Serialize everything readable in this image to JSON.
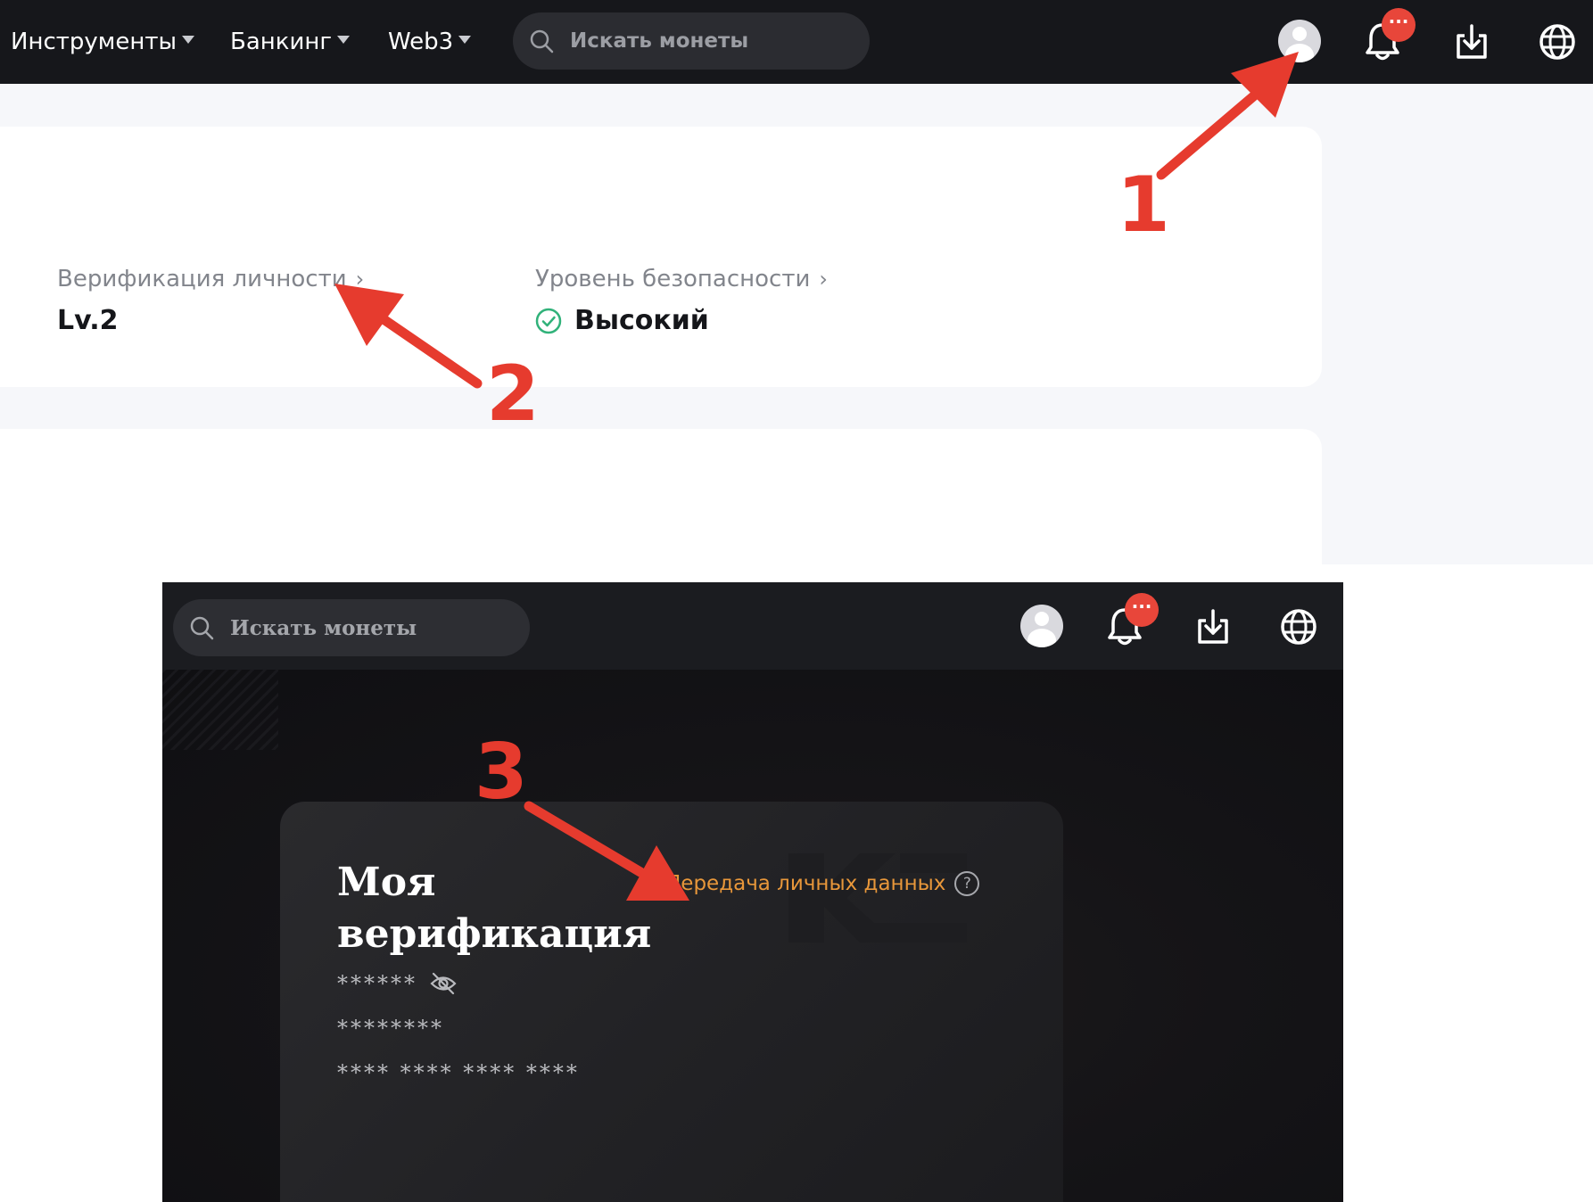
{
  "top": {
    "nav": [
      "Инструменты",
      "Банкинг",
      "Web3"
    ],
    "search_placeholder": "Искать монеты",
    "notification_badge": "···",
    "icons": [
      "search-icon",
      "avatar-icon",
      "bell-icon",
      "download-icon",
      "globe-icon",
      "chevron-right-icon",
      "check-circle-icon"
    ],
    "identity": {
      "label": "Верификация личности",
      "value": "Lv.2"
    },
    "security": {
      "label": "Уровень безопасности",
      "value": "Высокий",
      "status_color": "#31b27a"
    }
  },
  "bottom": {
    "search_placeholder": "Искать монеты",
    "notification_badge": "···",
    "verification": {
      "title": "Моя верификация",
      "transfer_link": "Передача личных данных",
      "help_glyph": "?",
      "masked_name": "******",
      "masked_id": "********",
      "masked_number": "**** **** **** ****"
    }
  },
  "annotations": {
    "step1": "1",
    "step2": "2",
    "step3": "3",
    "color": "#e63b2e"
  },
  "colors": {
    "topbar": "#16171b",
    "accent_orange": "#e8973a",
    "badge_red": "#e8463a"
  }
}
